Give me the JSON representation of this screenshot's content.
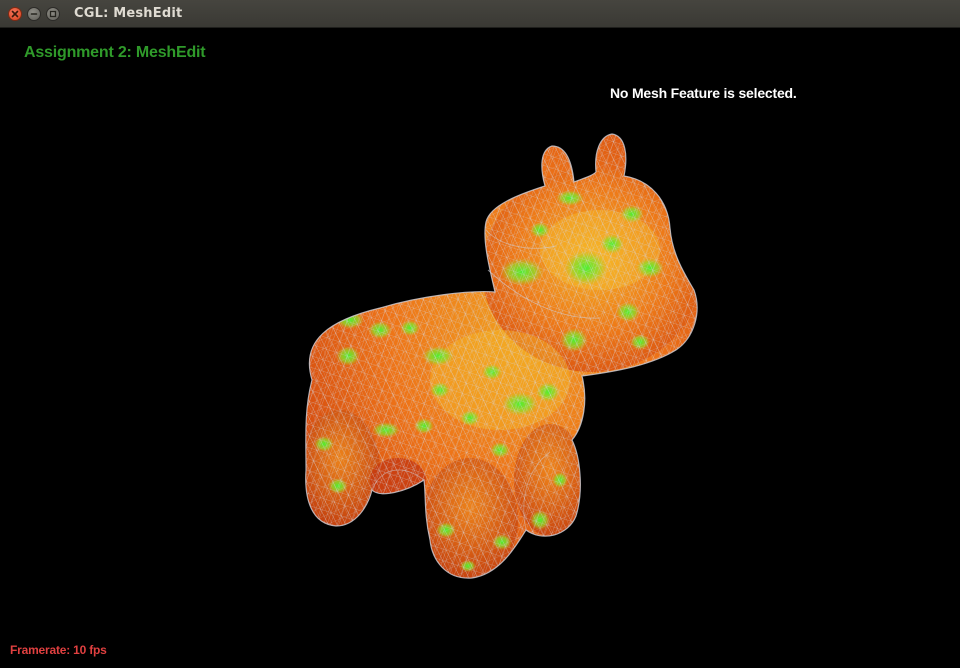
{
  "window": {
    "title": "CGL: MeshEdit",
    "controls": [
      "close-icon",
      "minimize-icon",
      "maximize-icon"
    ]
  },
  "viewer": {
    "heading": "Assignment 2: MeshEdit",
    "selection_status": "No Mesh Feature is selected.",
    "framerate_label": "Framerate:",
    "framerate_value": "10 fps"
  },
  "colors": {
    "heading": "#2f9a2a",
    "status": "#ffffff",
    "framerate": "#e04040",
    "mesh_warm": "#f05a14",
    "mesh_mid": "#e8a020",
    "mesh_cool": "#3cdc28",
    "wireframe": "#c8c8d2"
  }
}
